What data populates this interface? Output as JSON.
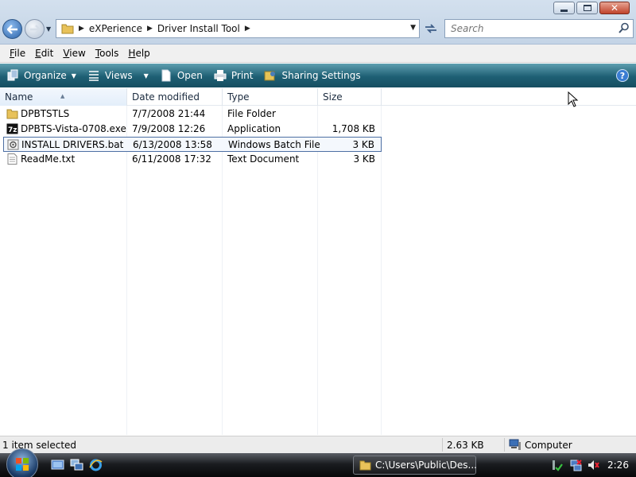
{
  "window": {
    "minimize_glyph": "",
    "close_glyph": "✕"
  },
  "address_bar": {
    "breadcrumbs": [
      "eXPerience",
      "Driver Install Tool"
    ],
    "search_placeholder": "Search"
  },
  "menu": {
    "items": [
      {
        "underline": "F",
        "rest": "ile"
      },
      {
        "underline": "E",
        "rest": "dit"
      },
      {
        "underline": "V",
        "rest": "iew"
      },
      {
        "underline": "T",
        "rest": "ools"
      },
      {
        "underline": "H",
        "rest": "elp"
      }
    ]
  },
  "command_bar": {
    "organize": "Organize",
    "views": "Views",
    "open": "Open",
    "print": "Print",
    "sharing": "Sharing Settings",
    "help": "?"
  },
  "columns": {
    "name": "Name",
    "date": "Date modified",
    "type": "Type",
    "size": "Size"
  },
  "files": [
    {
      "name": "DPBTSTLS",
      "date": "7/7/2008 21:44",
      "type": "File Folder",
      "size": "",
      "icon": "folder-icon"
    },
    {
      "name": "DPBTS-Vista-0708.exe",
      "date": "7/9/2008 12:26",
      "type": "Application",
      "size": "1,708 KB",
      "icon": "7zip-icon"
    },
    {
      "name": "INSTALL DRIVERS.bat",
      "date": "6/13/2008 13:58",
      "type": "Windows Batch File",
      "size": "3 KB",
      "icon": "batch-file-icon",
      "selected": true
    },
    {
      "name": "ReadMe.txt",
      "date": "6/11/2008 17:32",
      "type": "Text Document",
      "size": "3 KB",
      "icon": "text-file-icon"
    }
  ],
  "status": {
    "selection": "1 item selected",
    "size": "2.63 KB",
    "location": "Computer"
  },
  "taskbar": {
    "window_button": "C:\\Users\\Public\\Des...",
    "clock": "2:26"
  },
  "colors": {
    "command_bar": "#1e5f74",
    "selection_border": "#4d6fa3",
    "taskbar": "#070809"
  }
}
